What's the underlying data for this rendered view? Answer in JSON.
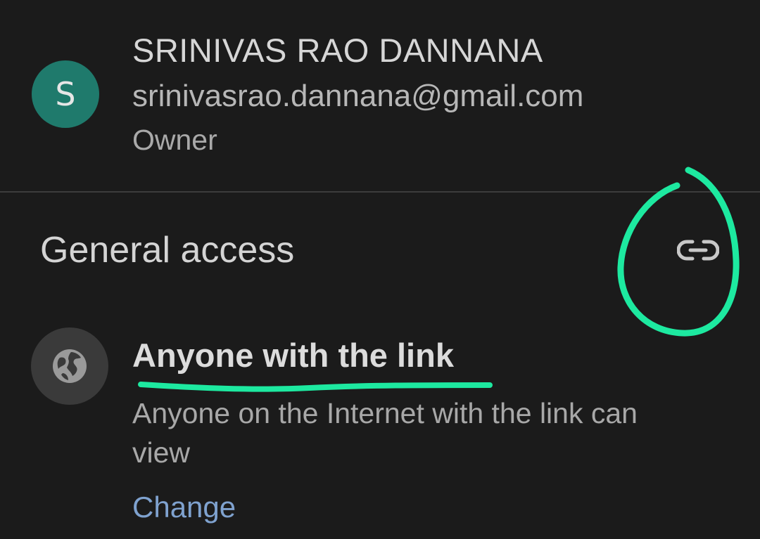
{
  "owner": {
    "avatar_letter": "S",
    "avatar_color": "#1f7a6c",
    "name": "SRINIVAS RAO DANNANA",
    "email": "srinivasrao.dannana@gmail.com",
    "role": "Owner"
  },
  "general_access": {
    "title": "General access",
    "link_icon": "link-icon",
    "option": {
      "icon": "globe-icon",
      "title": "Anyone with the link",
      "description": "Anyone on the Internet with the link can view",
      "change_label": "Change"
    }
  },
  "annotation_color": "#1de9a0"
}
